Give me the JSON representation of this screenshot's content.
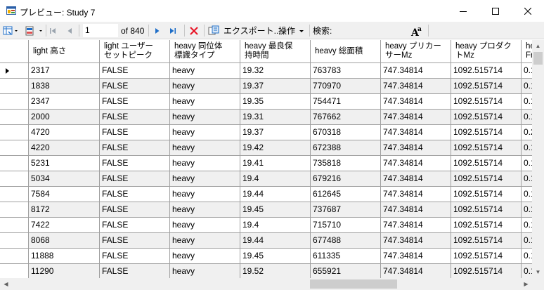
{
  "window": {
    "title": "プレビュー: Study 7",
    "minimize_icon": "minimize-icon",
    "maximize_icon": "maximize-icon",
    "close_icon": "close-icon"
  },
  "toolbar": {
    "position_value": "1",
    "of_count": "of 840",
    "export_label": "エクスポート...",
    "operations_label": "操作",
    "search_label": "検索:",
    "search_value": "",
    "delete_color": "#e81123",
    "accent_color": "#1e6ec8"
  },
  "grid": {
    "columns": [
      "light 高さ",
      "light ユーザー\nセットピーク",
      "heavy 同位体\n標識タイプ",
      "heavy 最良保\n持時間",
      "heavy 総面積",
      "heavy プリカー\nサーMz",
      "heavy プロダク\nトMz",
      "he\nFr"
    ],
    "rows": [
      [
        "2317",
        "FALSE",
        "heavy",
        "19.32",
        "763783",
        "747.34814",
        "1092.515714",
        "0.1"
      ],
      [
        "1838",
        "FALSE",
        "heavy",
        "19.37",
        "770970",
        "747.34814",
        "1092.515714",
        "0.1"
      ],
      [
        "2347",
        "FALSE",
        "heavy",
        "19.35",
        "754471",
        "747.34814",
        "1092.515714",
        "0.1"
      ],
      [
        "2000",
        "FALSE",
        "heavy",
        "19.31",
        "767662",
        "747.34814",
        "1092.515714",
        "0.1"
      ],
      [
        "4720",
        "FALSE",
        "heavy",
        "19.37",
        "670318",
        "747.34814",
        "1092.515714",
        "0.2"
      ],
      [
        "4220",
        "FALSE",
        "heavy",
        "19.42",
        "672388",
        "747.34814",
        "1092.515714",
        "0.1"
      ],
      [
        "5231",
        "FALSE",
        "heavy",
        "19.41",
        "735818",
        "747.34814",
        "1092.515714",
        "0.1"
      ],
      [
        "5034",
        "FALSE",
        "heavy",
        "19.4",
        "679216",
        "747.34814",
        "1092.515714",
        "0.1"
      ],
      [
        "7584",
        "FALSE",
        "heavy",
        "19.44",
        "612645",
        "747.34814",
        "1092.515714",
        "0.1"
      ],
      [
        "8172",
        "FALSE",
        "heavy",
        "19.45",
        "737687",
        "747.34814",
        "1092.515714",
        "0.1"
      ],
      [
        "7422",
        "FALSE",
        "heavy",
        "19.4",
        "715710",
        "747.34814",
        "1092.515714",
        "0.1"
      ],
      [
        "8068",
        "FALSE",
        "heavy",
        "19.44",
        "677488",
        "747.34814",
        "1092.515714",
        "0.1"
      ],
      [
        "11888",
        "FALSE",
        "heavy",
        "19.45",
        "611335",
        "747.34814",
        "1092.515714",
        "0.1"
      ],
      [
        "11290",
        "FALSE",
        "heavy",
        "19.52",
        "655921",
        "747.34814",
        "1092.515714",
        "0.1"
      ]
    ]
  }
}
